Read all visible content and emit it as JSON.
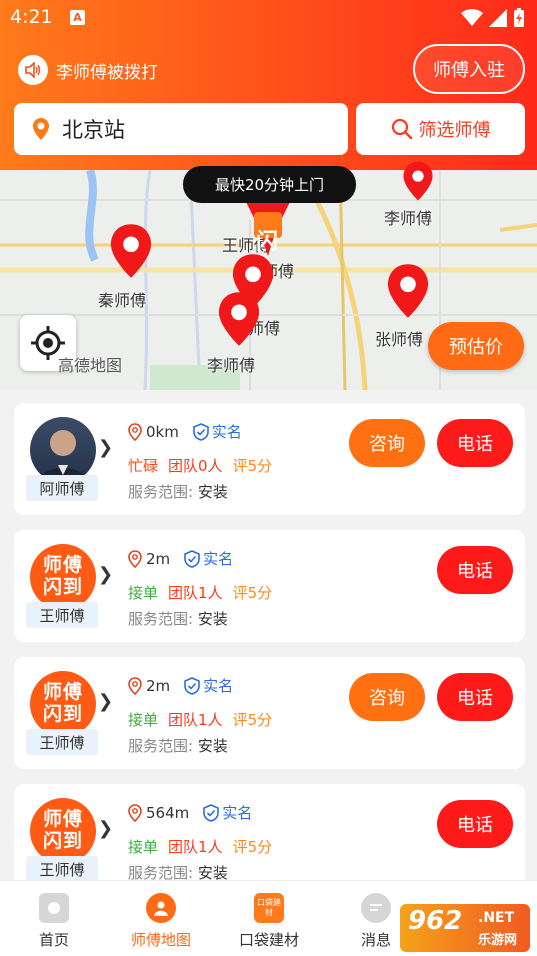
{
  "status_bar": {
    "time": "4:21",
    "badge": "A"
  },
  "header": {
    "notice_text": "李师傅被拨打",
    "join_label": "师傅入驻",
    "location_text": "北京站",
    "filter_label": "筛选师傅"
  },
  "map": {
    "tooltip": "最快20分钟上门",
    "badge_char": "闪",
    "estimate_label": "预估价",
    "brand": "高德地图",
    "labels": [
      "李师傅",
      "王师傅",
      "张师傅",
      "秦师傅",
      "王师傅",
      "李师傅",
      "张师傅"
    ]
  },
  "cards": [
    {
      "name": "阿师傅",
      "avatar": "photo",
      "distance": "0km",
      "verified": "实名",
      "status": "忙碌",
      "status_type": "busy",
      "team": "团队0人",
      "score": "评5分",
      "scope_label": "服务范围:",
      "scope": "安装",
      "consult": "咨询",
      "call": "电话"
    },
    {
      "name": "王师傅",
      "avatar": "logo",
      "distance": "2m",
      "verified": "实名",
      "status": "接单",
      "status_type": "ok",
      "team": "团队1人",
      "score": "评5分",
      "scope_label": "服务范围:",
      "scope": "安装",
      "consult": "",
      "call": "电话"
    },
    {
      "name": "王师傅",
      "avatar": "logo",
      "distance": "2m",
      "verified": "实名",
      "status": "接单",
      "status_type": "ok",
      "team": "团队1人",
      "score": "评5分",
      "scope_label": "服务范围:",
      "scope": "安装",
      "consult": "咨询",
      "call": "电话"
    },
    {
      "name": "王师傅",
      "avatar": "logo",
      "distance": "564m",
      "verified": "实名",
      "status": "接单",
      "status_type": "ok",
      "team": "团队1人",
      "score": "评5分",
      "scope_label": "服务范围:",
      "scope": "安装",
      "consult": "",
      "call": "电话"
    }
  ],
  "logo_text": {
    "line1": "师傅",
    "line2": "闪到"
  },
  "tabbar": {
    "tabs": [
      {
        "label": "首页",
        "icon": "home-icon"
      },
      {
        "label": "师傅地图",
        "icon": "map-worker-icon",
        "active": true
      },
      {
        "label": "口袋建材",
        "icon": "materials-icon",
        "icon_text": "口袋建材"
      },
      {
        "label": "消息",
        "icon": "message-icon"
      }
    ]
  },
  "watermark": {
    "num": "962",
    "net": ".NET",
    "sub": "乐游网"
  },
  "colors": {
    "accent": "#ff5a1a",
    "call": "#ff1a1a",
    "consult": "#ff7012",
    "verified": "#2b6de0",
    "ok": "#3cb043"
  }
}
